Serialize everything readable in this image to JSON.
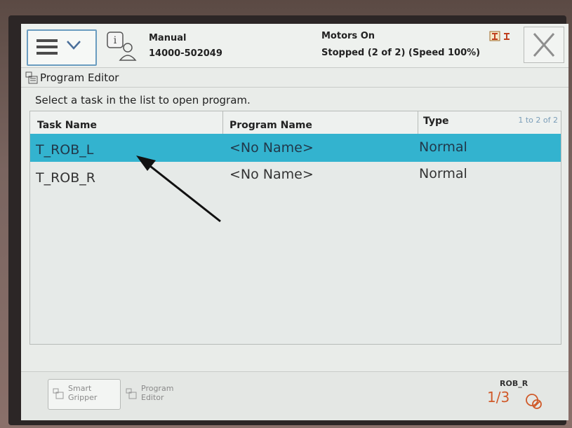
{
  "header": {
    "mode": "Manual",
    "controller_id": "14000-502049",
    "motors_status": "Motors On",
    "run_status": "Stopped (2 of 2) (Speed 100%)"
  },
  "app": {
    "title": "Program Editor"
  },
  "instruction": "Select a task in the list to open program.",
  "table": {
    "columns": [
      "Task Name",
      "Program Name",
      "Type"
    ],
    "count_label": "1 to 2 of 2",
    "rows": [
      {
        "task": "T_ROB_L",
        "program": "<No Name>",
        "type": "Normal",
        "selected": true
      },
      {
        "task": "T_ROB_R",
        "program": "<No Name>",
        "type": "Normal",
        "selected": false
      }
    ]
  },
  "taskbar": {
    "buttons": [
      {
        "label_line1": "Smart",
        "label_line2": "Gripper"
      },
      {
        "label_line1": "Program",
        "label_line2": "Editor"
      }
    ]
  },
  "status": {
    "robot": "ROB_R",
    "fraction": "1/3"
  },
  "colors": {
    "selection": "#33b3cf",
    "frame_border": "#6a9cc0",
    "speed_accent": "#d05a2a"
  }
}
